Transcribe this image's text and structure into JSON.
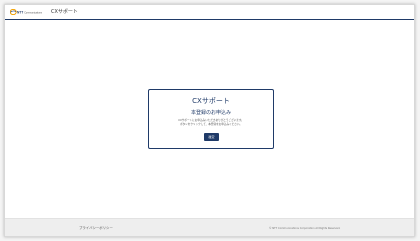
{
  "header": {
    "logo_text": "NTT Communications",
    "app_title": "CXサポート",
    "accent_color": "#1f3a68",
    "logo_color": "#f2a100"
  },
  "card": {
    "title": "CXサポート",
    "subtitle": "本登録のお申込み",
    "description_line1": "CXサポートにお申込みいただきありがとうございます。",
    "description_line2": "ボタンをクリックして、本登録をお申込みください。",
    "confirm_label": "確定"
  },
  "footer": {
    "privacy_label": "プライバシーポリシー",
    "copyright": "© NTT Communications Corporation All Rights Reserved."
  }
}
